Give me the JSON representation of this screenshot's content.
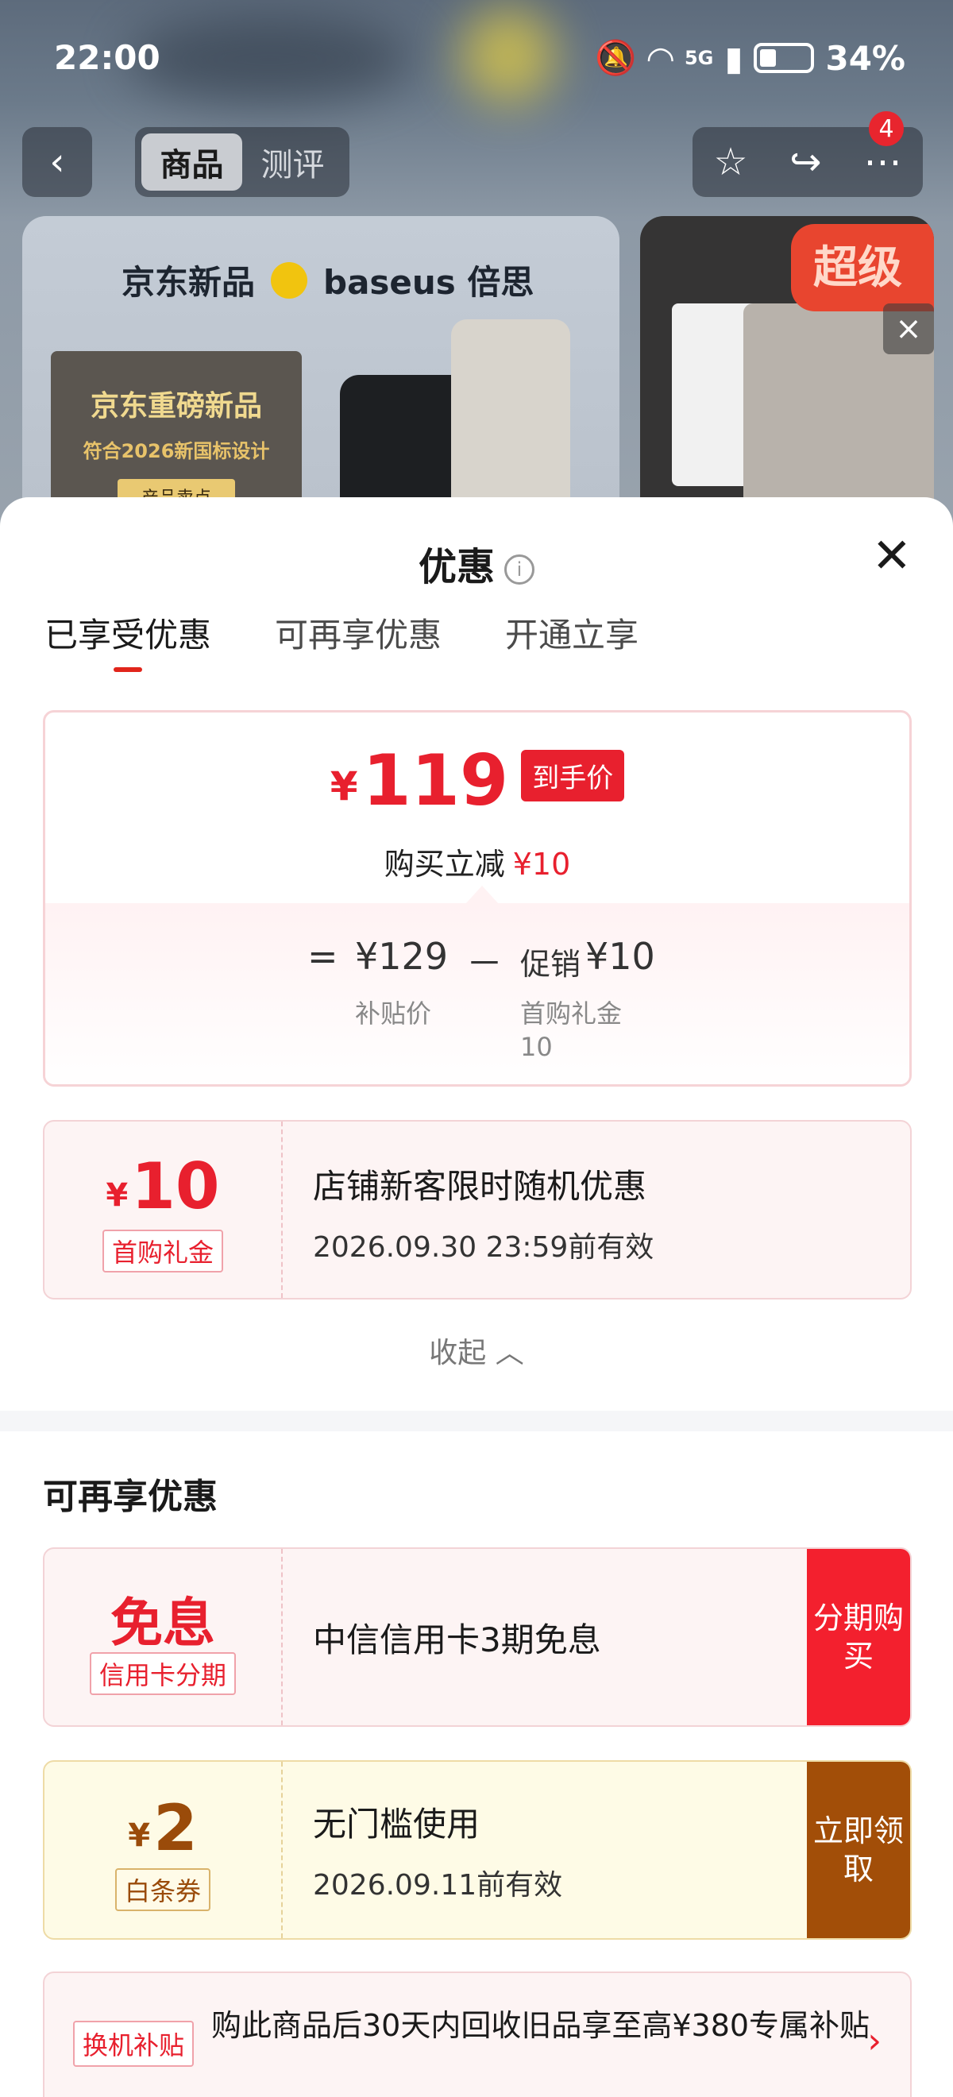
{
  "status_bar": {
    "time": "22:00",
    "network": "5G",
    "battery": "34%",
    "icons": [
      "mute-icon",
      "wifi-icon",
      "signal-icon",
      "battery-icon"
    ]
  },
  "nav": {
    "tabs": [
      {
        "label": "商品",
        "active": true
      },
      {
        "label": "测评",
        "active": false
      }
    ],
    "badge_count": "4"
  },
  "product_banner": {
    "brand_left": "京东新品",
    "brand_right": "baseus 倍思",
    "box_title": "京东重磅新品",
    "box_subtitle": "符合2026新国标设计",
    "box_button": "产品卖点",
    "side_badge": "超级"
  },
  "sheet": {
    "title": "优惠",
    "tabs": [
      {
        "label": "已享受优惠",
        "active": true
      },
      {
        "label": "可再享优惠",
        "active": false
      },
      {
        "label": "开通立享",
        "active": false
      }
    ],
    "price": {
      "currency": "¥",
      "final": "119",
      "final_tag": "到手价",
      "instant_label": "购买立减",
      "instant_value": "¥10",
      "equals": "=",
      "base_value": "¥129",
      "minus": "－",
      "promo_label": "促销",
      "promo_value": "¥10",
      "base_note": "补贴价",
      "promo_note_1": "首购礼金",
      "promo_note_2": "10"
    },
    "enjoyed_coupon": {
      "currency": "¥",
      "amount": "10",
      "label": "首购礼金",
      "title": "店铺新客限时随机优惠",
      "validity": "2026.09.30 23:59前有效"
    },
    "collapse_label": "收起",
    "more_section_title": "可再享优惠",
    "more_offers": [
      {
        "big_text": "免息",
        "label": "信用卡分期",
        "title": "中信信用卡3期免息",
        "action": "分期购买"
      },
      {
        "currency": "¥",
        "amount": "2",
        "label": "白条券",
        "title": "无门槛使用",
        "validity": "2026.09.11前有效",
        "action": "立即领取"
      }
    ],
    "trade_in": {
      "tag": "换机补贴",
      "text": "购此商品后30天内回收旧品享至高¥380专属补贴"
    }
  },
  "colors": {
    "accent_red": "#e8202e",
    "gold": "#a24e08"
  }
}
